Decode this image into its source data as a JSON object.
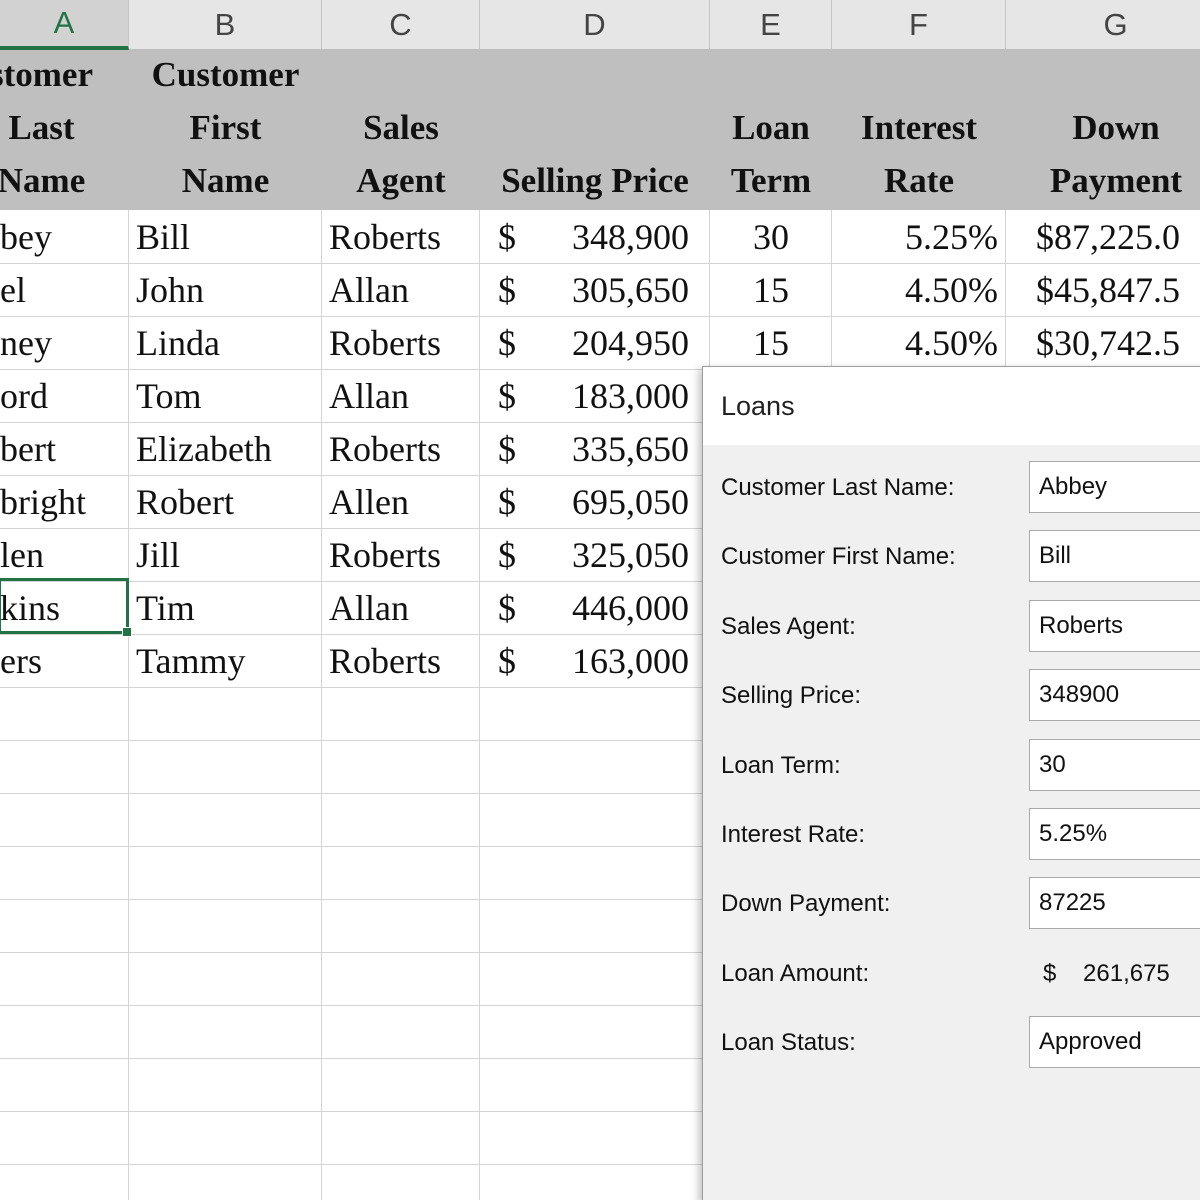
{
  "columns": [
    "A",
    "B",
    "C",
    "D",
    "E",
    "F",
    "G"
  ],
  "headers": {
    "a": "stomer\nLast\nName",
    "b": "Customer\nFirst\nName",
    "c": "Sales\nAgent",
    "d": "Selling Price",
    "e": "Loan\nTerm",
    "f": "Interest\nRate",
    "g": "Down\nPayment"
  },
  "rows": [
    {
      "last": "bey",
      "first": "Bill",
      "agent": "Roberts",
      "currency": "$",
      "price": "348,900",
      "term": "30",
      "rate": "5.25%",
      "down": "$87,225.0"
    },
    {
      "last": "el",
      "first": "John",
      "agent": "Allan",
      "currency": "$",
      "price": "305,650",
      "term": "15",
      "rate": "4.50%",
      "down": "$45,847.5"
    },
    {
      "last": "ney",
      "first": "Linda",
      "agent": "Roberts",
      "currency": "$",
      "price": "204,950",
      "term": "15",
      "rate": "4.50%",
      "down": "$30,742.5"
    },
    {
      "last": "ord",
      "first": "Tom",
      "agent": "Allan",
      "currency": "$",
      "price": "183,000"
    },
    {
      "last": "bert",
      "first": "Elizabeth",
      "agent": "Roberts",
      "currency": "$",
      "price": "335,650"
    },
    {
      "last": "bright",
      "first": "Robert",
      "agent": "Allen",
      "currency": "$",
      "price": "695,050"
    },
    {
      "last": "len",
      "first": "Jill",
      "agent": "Roberts",
      "currency": "$",
      "price": "325,050"
    },
    {
      "last": "kins",
      "first": "Tim",
      "agent": "Allan",
      "currency": "$",
      "price": "446,000"
    },
    {
      "last": "ers",
      "first": "Tammy",
      "agent": "Roberts",
      "currency": "$",
      "price": "163,000"
    }
  ],
  "dialog": {
    "title": "Loans",
    "labels": {
      "last": "Customer Last Name:",
      "first": "Customer First Name:",
      "agent": "Sales Agent:",
      "price": "Selling Price:",
      "term": "Loan Term:",
      "rate": "Interest Rate:",
      "down": "Down Payment:",
      "amount": "Loan Amount:",
      "status": "Loan Status:"
    },
    "values": {
      "last": "Abbey",
      "first": "Bill",
      "agent": "Roberts",
      "price": "348900",
      "term": "30",
      "rate": "5.25%",
      "down": "87225",
      "amount": "$    261,675",
      "status": "Approved"
    }
  },
  "colors": {
    "accent": "#217346",
    "header_band": "#bfbfbf",
    "column_header": "#e6e6e6",
    "dialog_bg": "#f0f0f0"
  }
}
